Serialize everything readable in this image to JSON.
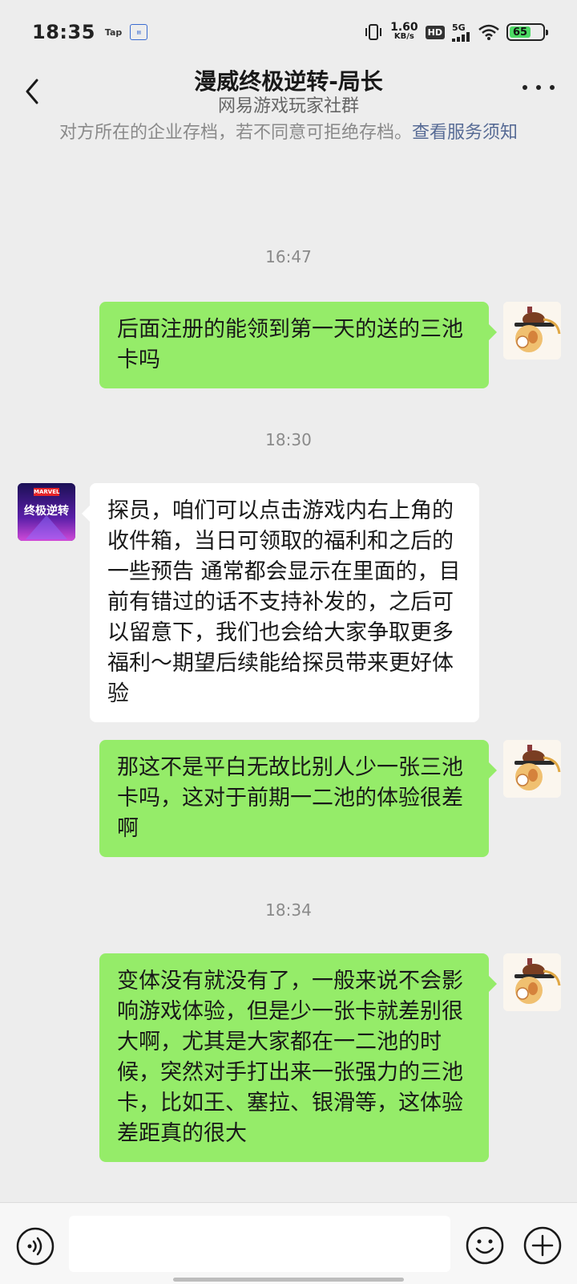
{
  "status_bar": {
    "time": "18:35",
    "tap_label": "Tap",
    "speed_value": "1.60",
    "speed_unit": "KB/s",
    "hd_label": "HD",
    "network": "5G",
    "battery": "65",
    "battery_level_pct": 65,
    "battery_color": "#4cd964"
  },
  "header": {
    "title": "漫威终极逆转-局长",
    "subtitle": "网易游戏玩家社群",
    "back_icon": "chevron-left-icon",
    "more_icon": "more-dots-icon"
  },
  "notice": {
    "text": "对方所在的企业存档，若不同意可拒绝存档。",
    "link": "查看服务须知"
  },
  "messages": [
    {
      "type": "time",
      "text": "16:47"
    },
    {
      "type": "out",
      "sender": "me",
      "text": "后面注册的能领到第一天的送的三池卡吗"
    },
    {
      "type": "time",
      "text": "18:30"
    },
    {
      "type": "in",
      "sender": "game",
      "text": "探员，咱们可以点击游戏内右上角的收件箱，当日可领取的福利和之后的一些预告 通常都会显示在里面的，目前有错过的话不支持补发的，之后可以留意下，我们也会给大家争取更多福利～期望后续能给探员带来更好体验"
    },
    {
      "type": "out",
      "sender": "me",
      "text": "那这不是平白无故比别人少一张三池卡吗，这对于前期一二池的体验很差啊"
    },
    {
      "type": "time",
      "text": "18:34"
    },
    {
      "type": "out",
      "sender": "me",
      "text": "变体没有就没有了，一般来说不会影响游戏体验，但是少一张卡就差别很大啊，尤其是大家都在一二池的时候，突然对手打出来一张强力的三池卡，比如王、塞拉、银滑等，这体验差距真的很大"
    }
  ],
  "game_avatar": {
    "line1": "MARVEL",
    "line2": "终极逆转"
  },
  "colors": {
    "out_bubble": "#95ec69",
    "in_bubble": "#ffffff",
    "background": "#ededed",
    "link": "#576b95"
  },
  "input_bar": {
    "voice_icon": "voice-icon",
    "emoji_icon": "emoji-icon",
    "plus_icon": "plus-icon"
  }
}
